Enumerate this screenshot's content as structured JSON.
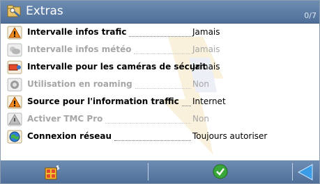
{
  "title": {
    "text": "Extras",
    "counter": "0/7"
  },
  "items": [
    {
      "label": "Intervalle infos trafic",
      "value": "Jamais",
      "icon": "traffic-warning-icon",
      "enabled": true
    },
    {
      "label": "Intervalle infos météo",
      "value": "Jamais",
      "icon": "weather-icon",
      "enabled": false
    },
    {
      "label": "Intervalle pour les caméras de sécurit",
      "value": "Jamais",
      "icon": "speed-camera-icon",
      "enabled": true
    },
    {
      "label": "Utilisation en roaming",
      "value": "Non",
      "icon": "roaming-icon",
      "enabled": false
    },
    {
      "label": "Source pour l'information traffic",
      "value": "Internet",
      "icon": "traffic-warning-icon",
      "enabled": true
    },
    {
      "label": "Activer TMC Pro",
      "value": "Non",
      "icon": "tmc-warning-icon",
      "enabled": false
    },
    {
      "label": "Connexion réseau",
      "value": "Toujours autoriser",
      "icon": "network-globe-icon",
      "enabled": true
    }
  ],
  "toolbar": {
    "left": "menu-grid-icon",
    "center": "confirm-check-icon",
    "right": "back-arrow-icon"
  },
  "colors": {
    "titlebar": "#5a7aa5",
    "toolbar": "#5a7aa5",
    "check": "#3aa63a",
    "back": "#3b9de8"
  }
}
